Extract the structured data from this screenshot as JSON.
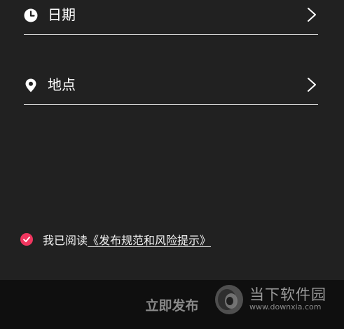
{
  "form": {
    "date_label": "日期",
    "location_label": "地点"
  },
  "agreement": {
    "checked": true,
    "prefix": "我已阅读",
    "link_text": "《发布规范和风险提示》"
  },
  "footer": {
    "publish_label": "立即发布"
  },
  "watermark": {
    "name": "当下软件园",
    "url": "www.downxia.com"
  },
  "colors": {
    "background": "#212121",
    "bottom_bar": "#0f0f0f",
    "checkbox_accent": "#f0365f",
    "publish_disabled_text": "#8a8a8a"
  },
  "icons": {
    "date": "clock-icon",
    "location": "map-pin-icon",
    "chevron": "chevron-right-icon",
    "checkbox": "check-icon"
  }
}
